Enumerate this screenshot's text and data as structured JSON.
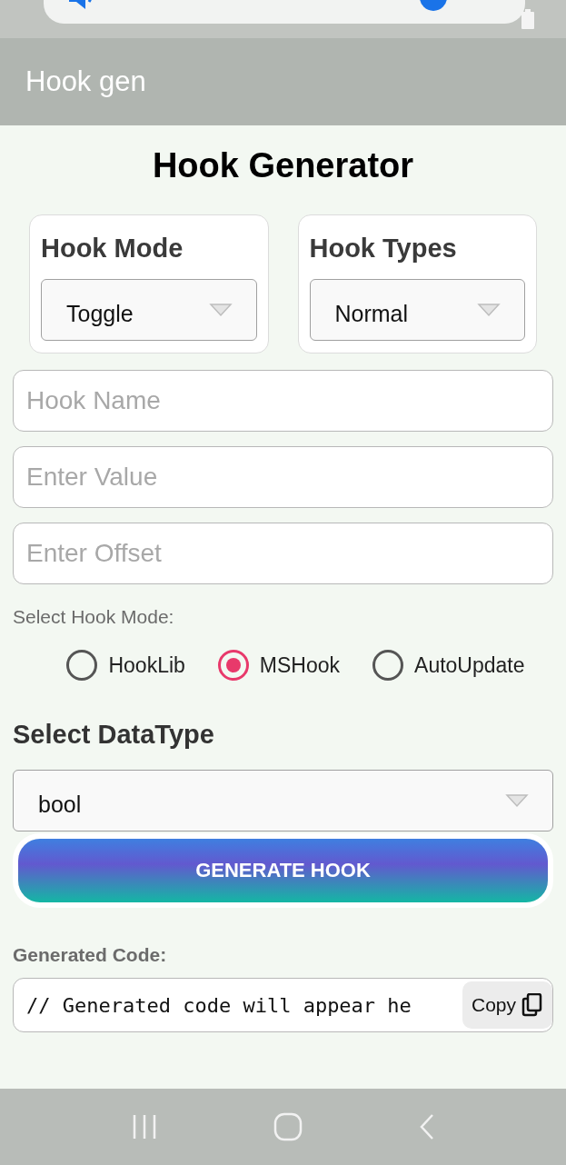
{
  "app_bar": {
    "title": "Hook gen"
  },
  "heading": "Hook Generator",
  "cards": [
    {
      "label": "Hook Mode",
      "value": "Toggle"
    },
    {
      "label": "Hook Types",
      "value": "Normal"
    }
  ],
  "fields": [
    {
      "placeholder": "Hook Name"
    },
    {
      "placeholder": "Enter Value"
    },
    {
      "placeholder": "Enter Offset"
    }
  ],
  "hook_mode": {
    "label": "Select Hook Mode:",
    "options": [
      {
        "label": "HookLib",
        "selected": false
      },
      {
        "label": "MSHook",
        "selected": true
      },
      {
        "label": "AutoUpdate",
        "selected": false
      }
    ]
  },
  "data_type": {
    "label": "Select DataType",
    "value": "bool"
  },
  "generate_button": "GENERATE HOOK",
  "output": {
    "label": "Generated Code:",
    "code": "// Generated code will appear he",
    "copy": "Copy"
  }
}
